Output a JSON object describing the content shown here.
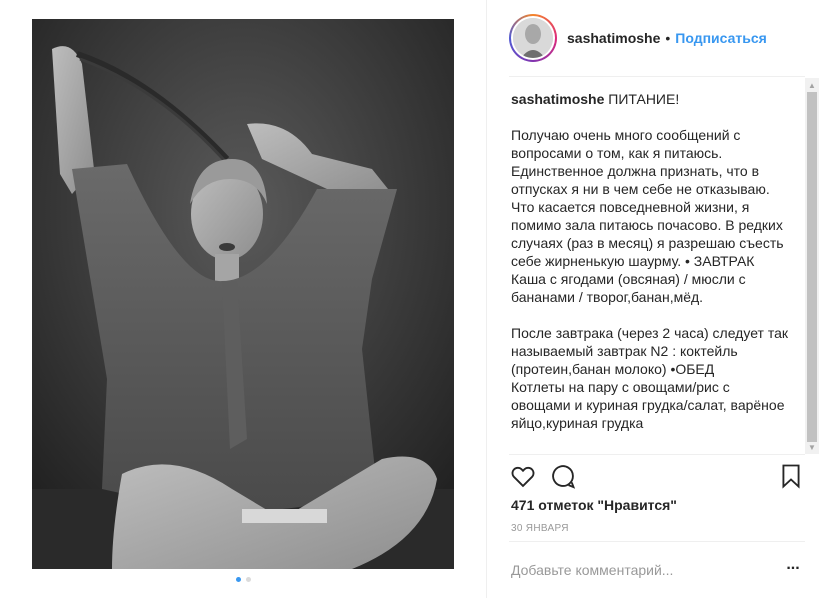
{
  "post": {
    "username": "sashatimoshe",
    "separator": "•",
    "follow_label": "Подписаться",
    "photo_alt": "black and white portrait photo",
    "caption": {
      "author": "sashatimoshe",
      "title": "ПИТАНИЕ!",
      "paragraph1": "Получаю очень много сообщений с вопросами о том, как я питаюсь. Единственное должна признать, что в отпусках я ни в чем себе не отказываю. Что касается повседневной жизни, я помимо зала питаюсь почасово. В редких случаях (раз в месяц) я разрешаю съесть себе жирненькую шаурму. • ЗАВТРАК Каша с ягодами (овсяная) / мюсли с бананами / творог,банан,мёд.",
      "paragraph2": "После завтрака (через 2 часа) следует так называемый завтрак N2 : коктейль (протеин,банан молоко) •ОБЕД\nКотлеты на пару с овощами/рис с овощами и куриная грудка/салат, варёное яйцо,куриная грудка"
    },
    "likes_text": "471 отметок \"Нравится\"",
    "date": "30 ЯНВАРЯ",
    "comment_placeholder": "Добавьте комментарий...",
    "more_label": "...",
    "carousel": {
      "count": 2,
      "active_index": 0
    }
  },
  "icons": {
    "like": "heart-icon",
    "comment": "comment-icon",
    "save": "bookmark-icon",
    "more": "more-options-icon"
  },
  "colors": {
    "link": "#3897f0",
    "text": "#262626",
    "muted": "#999999",
    "divider": "#efefef"
  }
}
